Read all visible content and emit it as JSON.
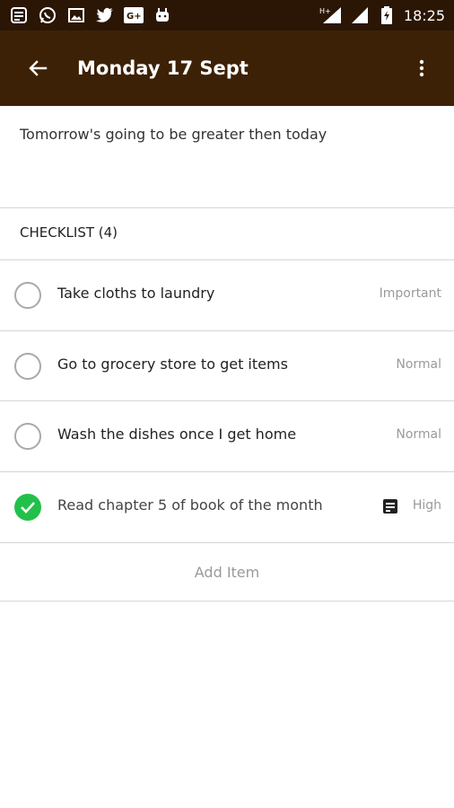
{
  "status_bar": {
    "time": "18:25",
    "network_label": "H+",
    "icons": [
      "notes-icon",
      "whatsapp-icon",
      "gallery-icon",
      "twitter-icon",
      "google-plus-icon",
      "android-icon"
    ]
  },
  "app_bar": {
    "title": "Monday 17 Sept"
  },
  "note": {
    "text": "Tomorrow's going to be greater then today"
  },
  "checklist": {
    "header": "CHECKLIST (4)",
    "items": [
      {
        "text": "Take cloths to laundry",
        "priority": "Important",
        "done": false
      },
      {
        "text": "Go to grocery store to get items",
        "priority": "Normal",
        "done": false
      },
      {
        "text": "Wash the dishes once I get home",
        "priority": "Normal",
        "done": false
      },
      {
        "text": "Read chapter 5 of book of the month",
        "priority": "High",
        "done": true
      }
    ],
    "add_label": "Add Item"
  },
  "colors": {
    "status_bar": "#2b1605",
    "app_bar": "#3d2107",
    "check_done": "#22c04a"
  }
}
